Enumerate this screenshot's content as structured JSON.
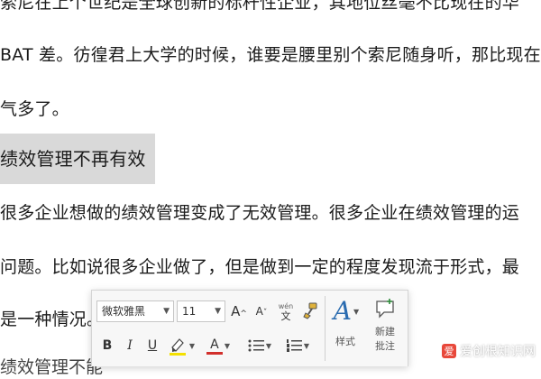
{
  "document": {
    "lines": [
      "索尼在上个世纪是全球创新的标杆性企业，其地位丝毫不比现在的华",
      "BAT 差。彷徨君上大学的时候，谁要是腰里别个索尼随身听，那比现在",
      "气多了。",
      "很多企业想做的绩效管理变成了无效管理。很多企业在绩效管理的运",
      "问题。比如说很多企业做了，但是做到一定的程度发现流于形式，最",
      "是一种情况。"
    ],
    "heading": "绩效管理不再有效",
    "partial_heading": "绩效管理不能"
  },
  "mini_toolbar": {
    "font_name": "微软雅黑",
    "font_size": "11",
    "grow_font": "A",
    "shrink_font": "A",
    "phonetic_top": "wén",
    "phonetic_bottom": "文",
    "bold": "B",
    "italic": "I",
    "underline": "U",
    "font_color_letter": "A",
    "styles_label": "样式",
    "new_comment_label_1": "新建",
    "new_comment_label_2": "批注",
    "colors": {
      "highlight": "#f4e000",
      "font_color": "#d2302c",
      "styles_icon": "#2b6cb0"
    }
  },
  "watermark": {
    "logo_char": "爱",
    "text": "爱创根知识网"
  }
}
